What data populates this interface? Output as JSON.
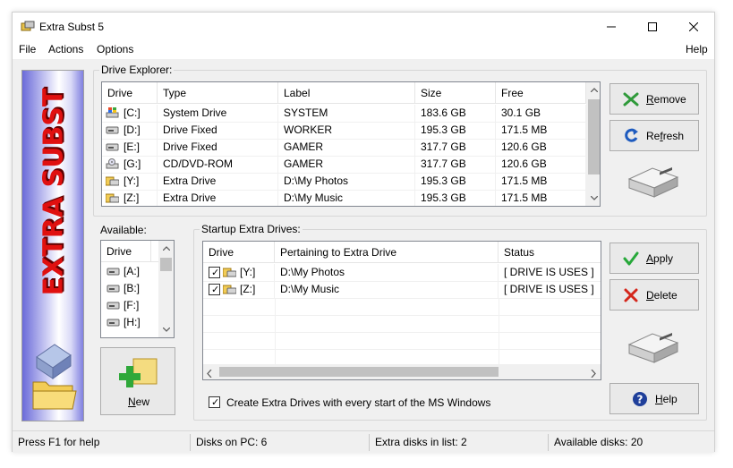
{
  "window": {
    "title": "Extra Subst 5"
  },
  "menu": {
    "file": "File",
    "actions": "Actions",
    "options": "Options",
    "help": "Help"
  },
  "banner": {
    "text": "EXTRA SUBST"
  },
  "drive_explorer": {
    "label": "Drive Explorer:",
    "columns": [
      "Drive",
      "Type",
      "Label",
      "Size",
      "Free"
    ],
    "rows": [
      {
        "drive": "[C:]",
        "type": "System Drive",
        "label": "SYSTEM",
        "size": "183.6 GB",
        "free": "30.1 GB",
        "icon": "windows-drive-icon"
      },
      {
        "drive": "[D:]",
        "type": "Drive Fixed",
        "label": "WORKER",
        "size": "195.3 GB",
        "free": "171.5 MB",
        "icon": "hard-drive-icon"
      },
      {
        "drive": "[E:]",
        "type": "Drive Fixed",
        "label": "GAMER",
        "size": "317.7 GB",
        "free": "120.6 GB",
        "icon": "hard-drive-icon"
      },
      {
        "drive": "[G:]",
        "type": "CD/DVD-ROM",
        "label": "GAMER",
        "size": "317.7 GB",
        "free": "120.6 GB",
        "icon": "cd-drive-icon"
      },
      {
        "drive": "[Y:]",
        "type": "Extra Drive",
        "label": "D:\\My Photos",
        "size": "195.3 GB",
        "free": "171.5 MB",
        "icon": "extra-drive-icon"
      },
      {
        "drive": "[Z:]",
        "type": "Extra Drive",
        "label": "D:\\My Music",
        "size": "195.3 GB",
        "free": "171.5 MB",
        "icon": "extra-drive-icon"
      }
    ]
  },
  "buttons": {
    "remove_pre": "",
    "remove_ul": "R",
    "remove_post": "emove",
    "refresh_pre": "Re",
    "refresh_ul": "f",
    "refresh_post": "resh",
    "apply_pre": "",
    "apply_ul": "A",
    "apply_post": "pply",
    "delete_pre": "",
    "delete_ul": "D",
    "delete_post": "elete",
    "help_pre": "",
    "help_ul": "H",
    "help_post": "elp",
    "new_pre": "",
    "new_ul": "N",
    "new_post": "ew"
  },
  "available": {
    "label": "Available:",
    "column": "Drive",
    "rows": [
      "[A:]",
      "[B:]",
      "[F:]",
      "[H:]"
    ]
  },
  "startup": {
    "label": "Startup Extra Drives:",
    "columns": [
      "Drive",
      "Pertaining to Extra Drive",
      "Status"
    ],
    "rows": [
      {
        "drive": "[Y:]",
        "target": "D:\\My Photos",
        "status": "[ DRIVE IS USES ]",
        "checked": true
      },
      {
        "drive": "[Z:]",
        "target": "D:\\My Music",
        "status": "[ DRIVE IS USES ]",
        "checked": true
      }
    ],
    "checkbox_label": "Create Extra Drives with every start of the MS Windows",
    "checkbox_checked": true
  },
  "status": {
    "help": "Press F1 for help",
    "disks_on_pc": "Disks on PC: 6",
    "extra_disks": "Extra disks in list: 2",
    "available_disks": "Available disks: 20"
  },
  "colors": {
    "banner_text": "#e01010",
    "accent_blue": "#1e5bbf",
    "apply_green": "#27a83a",
    "delete_red": "#d4261b"
  }
}
